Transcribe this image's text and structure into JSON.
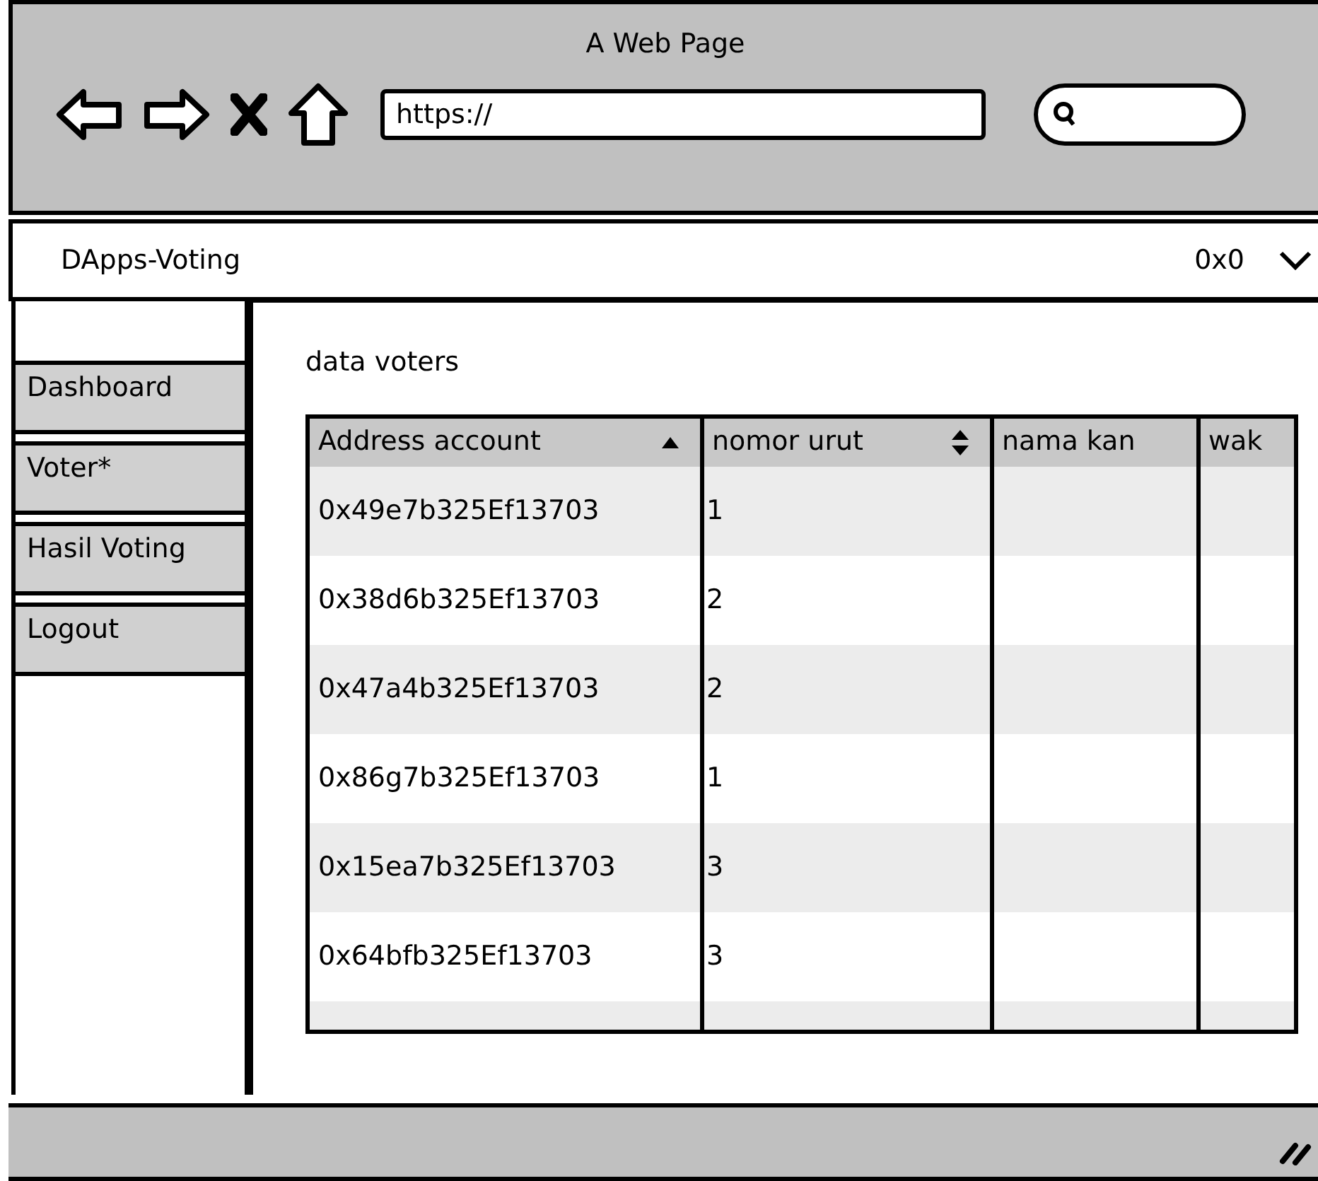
{
  "window": {
    "title": "A Web Page"
  },
  "toolbar": {
    "url": "https://"
  },
  "app_bar": {
    "brand": "DApps-Voting",
    "account": "0x0"
  },
  "sidebar": {
    "items": [
      {
        "label": "Dashboard"
      },
      {
        "label": "Voter*"
      },
      {
        "label": "Hasil Voting"
      },
      {
        "label": "Logout"
      }
    ]
  },
  "content": {
    "heading": "data voters",
    "table": {
      "columns": [
        {
          "label": "Address account",
          "kind": "ascending"
        },
        {
          "label": "nomor urut",
          "kind": "sortable"
        },
        {
          "label": "nama kan",
          "kind": "plain"
        },
        {
          "label": "wak",
          "kind": "plain"
        }
      ],
      "rows": [
        {
          "address": "0x49e7b325Ef13703",
          "number": "1"
        },
        {
          "address": "0x38d6b325Ef13703",
          "number": "2"
        },
        {
          "address": "0x47a4b325Ef13703",
          "number": "2"
        },
        {
          "address": "0x86g7b325Ef13703",
          "number": "1"
        },
        {
          "address": "0x15ea7b325Ef13703",
          "number": "3"
        },
        {
          "address": "0x64bfb325Ef13703",
          "number": "3"
        }
      ]
    }
  }
}
